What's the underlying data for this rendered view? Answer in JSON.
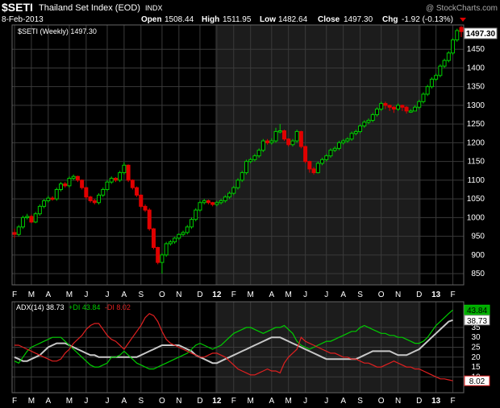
{
  "header": {
    "symbol": "$SETI",
    "name": "Thailand Set Index (EOD)",
    "exchange": "INDX",
    "date": "8-Feb-2013",
    "watermark": "@ StockCharts.com",
    "open_label": "Open",
    "open": "1508.44",
    "high_label": "High",
    "high": "1511.95",
    "low_label": "Low",
    "low": "1482.64",
    "close_label": "Close",
    "close": "1497.30",
    "chg_label": "Chg",
    "chg": "-1.92 (-0.13%)",
    "price_legend": "$SETI (Weekly) 1497.30",
    "last_price_badge": "1497.30"
  },
  "colors": {
    "background": "#000000",
    "up": "#00cc00",
    "down": "#e00000",
    "grid": "#3a3a3a",
    "shade": "#1c1c1c",
    "adx": "#c8c8c8",
    "plus_di": "#00cc00",
    "minus_di": "#e02020"
  },
  "chart_data": [
    {
      "type": "candlestick",
      "series_name": "$SETI (Weekly)",
      "ylim": [
        820,
        1515
      ],
      "yticks": [
        850,
        900,
        950,
        1000,
        1050,
        1100,
        1150,
        1200,
        1250,
        1300,
        1350,
        1400,
        1450
      ],
      "xticks": [
        "F",
        "M",
        "A",
        "M",
        "J",
        "J",
        "A",
        "S",
        "O",
        "N",
        "D",
        "12",
        "F",
        "M",
        "A",
        "M",
        "J",
        "J",
        "A",
        "S",
        "O",
        "N",
        "D",
        "13",
        "F"
      ],
      "xtick_weeks": [
        0,
        4,
        8,
        13,
        17,
        22,
        26,
        30,
        35,
        39,
        44,
        48,
        52,
        56,
        61,
        65,
        69,
        74,
        78,
        82,
        87,
        91,
        96,
        100,
        104
      ],
      "shaded_weeks": [
        48,
        96
      ],
      "closes": [
        955,
        975,
        1000,
        1003,
        988,
        1010,
        1030,
        1045,
        1052,
        1050,
        1075,
        1090,
        1085,
        1105,
        1110,
        1100,
        1080,
        1055,
        1045,
        1040,
        1060,
        1075,
        1095,
        1105,
        1100,
        1120,
        1140,
        1100,
        1080,
        1060,
        1030,
        1020,
        970,
        920,
        880,
        900,
        930,
        935,
        945,
        955,
        960,
        975,
        995,
        1020,
        1040,
        1045,
        1040,
        1035,
        1040,
        1045,
        1055,
        1065,
        1080,
        1100,
        1120,
        1150,
        1155,
        1165,
        1180,
        1205,
        1200,
        1205,
        1230,
        1232,
        1210,
        1195,
        1205,
        1230,
        1190,
        1150,
        1130,
        1120,
        1145,
        1155,
        1165,
        1180,
        1185,
        1200,
        1205,
        1210,
        1225,
        1230,
        1245,
        1255,
        1260,
        1275,
        1290,
        1305,
        1300,
        1295,
        1290,
        1300,
        1295,
        1285,
        1285,
        1295,
        1310,
        1330,
        1350,
        1370,
        1380,
        1405,
        1420,
        1440,
        1475,
        1500,
        1497.3
      ],
      "opens": [
        960,
        955,
        975,
        1000,
        1003,
        988,
        1010,
        1030,
        1045,
        1052,
        1050,
        1075,
        1090,
        1085,
        1105,
        1110,
        1100,
        1080,
        1055,
        1045,
        1040,
        1060,
        1075,
        1095,
        1105,
        1100,
        1120,
        1140,
        1100,
        1080,
        1060,
        1030,
        1020,
        970,
        920,
        880,
        900,
        930,
        935,
        945,
        955,
        960,
        975,
        995,
        1020,
        1040,
        1045,
        1040,
        1035,
        1040,
        1045,
        1055,
        1065,
        1080,
        1100,
        1120,
        1150,
        1155,
        1165,
        1180,
        1205,
        1200,
        1205,
        1230,
        1232,
        1210,
        1195,
        1205,
        1230,
        1190,
        1150,
        1130,
        1120,
        1145,
        1155,
        1165,
        1180,
        1185,
        1200,
        1205,
        1210,
        1225,
        1230,
        1245,
        1255,
        1260,
        1275,
        1290,
        1305,
        1300,
        1295,
        1290,
        1300,
        1295,
        1285,
        1285,
        1295,
        1310,
        1330,
        1350,
        1370,
        1380,
        1405,
        1420,
        1440,
        1475,
        1508.44
      ],
      "highs": [
        970,
        980,
        1005,
        1010,
        1008,
        1015,
        1035,
        1050,
        1058,
        1057,
        1080,
        1095,
        1095,
        1110,
        1115,
        1112,
        1102,
        1082,
        1058,
        1050,
        1065,
        1080,
        1100,
        1110,
        1108,
        1125,
        1148,
        1142,
        1102,
        1083,
        1062,
        1035,
        1025,
        972,
        922,
        905,
        935,
        940,
        948,
        958,
        965,
        980,
        1000,
        1025,
        1045,
        1050,
        1048,
        1042,
        1045,
        1050,
        1060,
        1070,
        1085,
        1105,
        1125,
        1155,
        1160,
        1170,
        1185,
        1210,
        1210,
        1212,
        1240,
        1250,
        1235,
        1212,
        1210,
        1235,
        1232,
        1192,
        1152,
        1135,
        1150,
        1160,
        1170,
        1185,
        1190,
        1205,
        1210,
        1215,
        1230,
        1235,
        1250,
        1260,
        1265,
        1280,
        1295,
        1310,
        1310,
        1302,
        1298,
        1305,
        1302,
        1298,
        1290,
        1300,
        1315,
        1335,
        1355,
        1375,
        1385,
        1410,
        1425,
        1445,
        1480,
        1505,
        1511.95
      ],
      "lows": [
        945,
        950,
        970,
        995,
        985,
        985,
        1005,
        1025,
        1040,
        1045,
        1045,
        1070,
        1080,
        1080,
        1100,
        1095,
        1075,
        1050,
        1040,
        1035,
        1035,
        1055,
        1070,
        1090,
        1095,
        1095,
        1115,
        1095,
        1075,
        1055,
        1025,
        1015,
        965,
        915,
        875,
        850,
        895,
        925,
        930,
        940,
        950,
        955,
        970,
        990,
        1015,
        1035,
        1035,
        1030,
        1030,
        1035,
        1040,
        1050,
        1060,
        1075,
        1095,
        1115,
        1145,
        1150,
        1160,
        1175,
        1195,
        1195,
        1200,
        1225,
        1205,
        1190,
        1190,
        1200,
        1185,
        1145,
        1120,
        1115,
        1118,
        1140,
        1150,
        1160,
        1175,
        1180,
        1195,
        1200,
        1205,
        1220,
        1225,
        1240,
        1250,
        1255,
        1270,
        1285,
        1290,
        1285,
        1280,
        1285,
        1285,
        1278,
        1280,
        1285,
        1290,
        1305,
        1325,
        1345,
        1365,
        1375,
        1400,
        1415,
        1435,
        1470,
        1482.64
      ]
    },
    {
      "type": "line",
      "title": "ADX(14) 38.73 +DI 43.84 -DI 8.02",
      "ylim": [
        2,
        48
      ],
      "yticks": [
        10,
        15,
        20,
        25,
        30,
        35
      ],
      "series": [
        {
          "name": "ADX(14)",
          "label": "ADX(14) 38.73",
          "last": "38.73",
          "values": [
            20,
            19,
            18,
            18,
            19,
            20,
            21,
            23,
            25,
            26,
            27,
            27,
            27,
            26,
            25,
            24,
            23,
            22,
            21,
            21,
            20,
            20,
            20,
            20,
            20,
            20,
            20,
            20,
            20,
            20,
            21,
            22,
            23,
            24,
            25,
            26,
            26,
            26,
            26,
            26,
            25,
            24,
            23,
            21,
            20,
            19,
            18,
            17,
            17,
            18,
            19,
            20,
            21,
            22,
            23,
            24,
            25,
            26,
            27,
            28,
            29,
            30,
            30,
            30,
            29,
            28,
            27,
            26,
            25,
            24,
            23,
            22,
            21,
            20,
            19,
            19,
            19,
            19,
            19,
            19,
            19,
            19,
            20,
            21,
            22,
            23,
            23,
            23,
            23,
            23,
            22,
            21,
            21,
            21,
            22,
            23,
            24,
            26,
            28,
            30,
            32,
            34,
            36,
            38,
            38.73
          ]
        },
        {
          "name": "+DI",
          "label": "+DI 43.84",
          "last": "43.84",
          "values": [
            18,
            17,
            20,
            23,
            25,
            26,
            27,
            28,
            29,
            30,
            30,
            30,
            28,
            26,
            24,
            22,
            20,
            18,
            16,
            15,
            15,
            16,
            17,
            20,
            20,
            21,
            23,
            21,
            19,
            17,
            16,
            15,
            14,
            14,
            15,
            16,
            17,
            18,
            19,
            20,
            21,
            22,
            24,
            26,
            27,
            26,
            25,
            24,
            25,
            26,
            28,
            30,
            32,
            33,
            34,
            35,
            35,
            34,
            33,
            32,
            33,
            34,
            35,
            35,
            36,
            34,
            32,
            28,
            26,
            25,
            24,
            25,
            26,
            27,
            28,
            28,
            29,
            30,
            31,
            32,
            33,
            33,
            35,
            36,
            35,
            34,
            33,
            32,
            32,
            31,
            31,
            30,
            30,
            29,
            28,
            27,
            27,
            28,
            30,
            33,
            36,
            38,
            40,
            42,
            43.84
          ]
        },
        {
          "name": "-DI",
          "label": "-DI 8.02",
          "last": "8.02",
          "values": [
            26,
            26,
            25,
            24,
            23,
            22,
            21,
            20,
            19,
            18,
            18,
            19,
            22,
            24,
            27,
            29,
            31,
            34,
            36,
            37,
            37,
            34,
            31,
            29,
            28,
            26,
            24,
            27,
            30,
            33,
            36,
            40,
            42,
            41,
            38,
            33,
            29,
            27,
            26,
            25,
            24,
            23,
            22,
            21,
            20,
            20,
            21,
            22,
            22,
            21,
            20,
            18,
            16,
            14,
            13,
            12,
            11,
            11,
            12,
            13,
            14,
            13,
            13,
            12,
            17,
            20,
            22,
            24,
            30,
            28,
            27,
            26,
            25,
            24,
            23,
            22,
            22,
            21,
            20,
            20,
            19,
            19,
            18,
            17,
            17,
            16,
            15,
            15,
            16,
            17,
            18,
            17,
            16,
            15,
            15,
            14,
            14,
            13,
            12,
            11,
            10,
            9,
            9,
            8.5,
            8.02
          ]
        }
      ],
      "xticks": [
        "F",
        "M",
        "A",
        "M",
        "J",
        "J",
        "A",
        "S",
        "O",
        "N",
        "D",
        "12",
        "F",
        "M",
        "A",
        "M",
        "J",
        "J",
        "A",
        "S",
        "O",
        "N",
        "D",
        "13",
        "F"
      ]
    }
  ]
}
